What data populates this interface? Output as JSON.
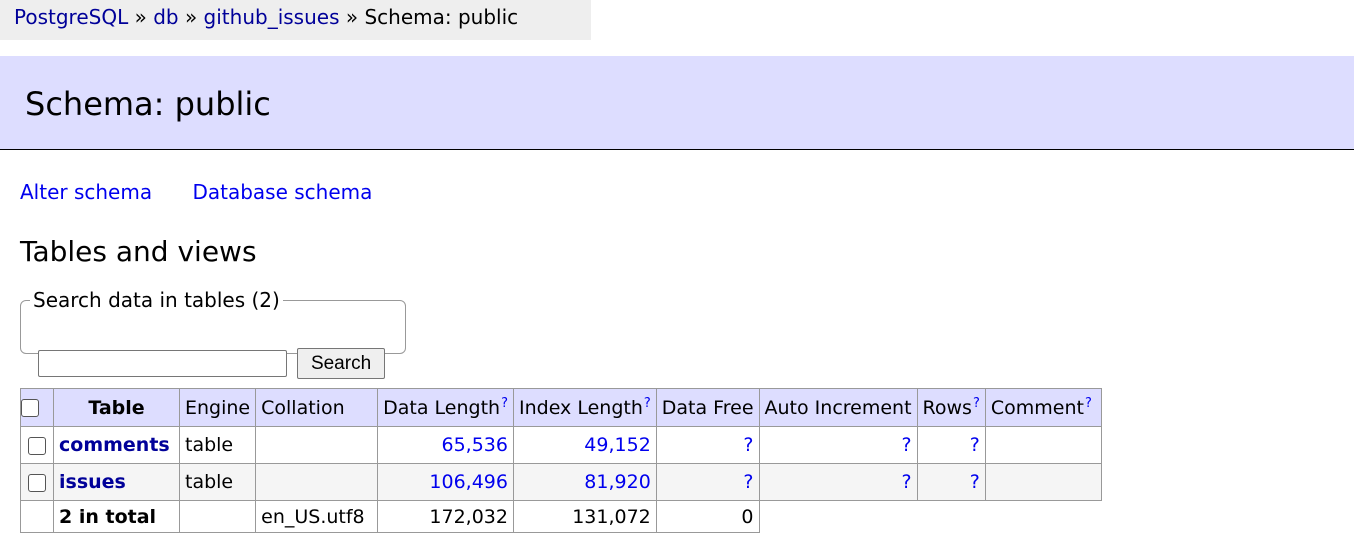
{
  "breadcrumb": {
    "items": [
      "PostgreSQL",
      "db",
      "github_issues"
    ],
    "separator": "»",
    "current": "Schema: public"
  },
  "header": {
    "title": "Schema: public"
  },
  "links": {
    "alter_schema": "Alter schema",
    "database_schema": "Database schema"
  },
  "section_title": "Tables and views",
  "search": {
    "legend": "Search data in tables (2)",
    "value": "",
    "button_label": "Search"
  },
  "table": {
    "columns": {
      "table": "Table",
      "engine": "Engine",
      "collation": "Collation",
      "data_length": "Data Length",
      "index_length": "Index Length",
      "data_free": "Data Free",
      "auto_increment": "Auto Increment",
      "rows": "Rows",
      "comment": "Comment",
      "help_mark": "?"
    },
    "rows": [
      {
        "name": "comments",
        "engine": "table",
        "collation": "",
        "data_length": "65,536",
        "index_length": "49,152",
        "data_free": "?",
        "auto_increment": "?",
        "rows": "?",
        "comment": ""
      },
      {
        "name": "issues",
        "engine": "table",
        "collation": "",
        "data_length": "106,496",
        "index_length": "81,920",
        "data_free": "?",
        "auto_increment": "?",
        "rows": "?",
        "comment": ""
      }
    ],
    "total": {
      "label": "2 in total",
      "collation": "en_US.utf8",
      "data_length": "172,032",
      "index_length": "131,072",
      "data_free": "0"
    }
  },
  "colors": {
    "header_bg": "#ddddff",
    "breadcrumb_bg": "#eeeeee",
    "link": "#0000ee",
    "table_link": "#000099"
  }
}
